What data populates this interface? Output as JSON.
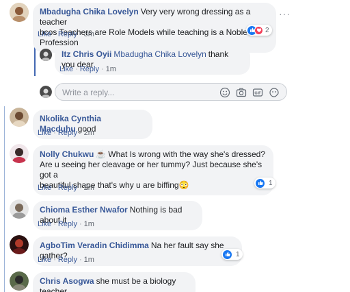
{
  "colors": {
    "link": "#385898",
    "bubble": "#f2f3f5",
    "thread_line": "#4267b2",
    "like_blue": "#1877f2",
    "love_red": "#f33e58"
  },
  "actions": {
    "like": "Like",
    "reply": "Reply",
    "separator": "·"
  },
  "reply_box": {
    "placeholder": "Write a reply...",
    "icons": [
      "smiley-icon",
      "camera-icon",
      "gif-icon",
      "sticker-icon"
    ]
  },
  "comments": [
    {
      "name": "Mbadugha Chika Lovelyn",
      "text_line1": "Very very wrong dressing as a teacher",
      "text_line2": "bcos Teachers are Role Models while teaching is a Noble Profession",
      "time": "3m",
      "reactions": [
        "like",
        "love"
      ],
      "reaction_count": "2"
    },
    {
      "name": "Itz Chris Oyii",
      "tag": "Mbadugha Chika Lovelyn",
      "text": "thank you dear",
      "time": "1m"
    },
    {
      "name": "Nkolika Cynthia Macduhu",
      "text": "good",
      "time": "2m"
    },
    {
      "name": "Nolly Chukwu",
      "name_suffix": "☕",
      "text_line1": "What Is wrong with the way she's dressed?",
      "text_line2": "Are u seeing her cleavage or her tummy? Just because she's got a",
      "text_line3": "beautiful shape that's why u are biffing",
      "emoji": "😳",
      "time": "2m",
      "reactions": [
        "like"
      ],
      "reaction_count": "1"
    },
    {
      "name": "Chioma Esther Nwafor",
      "text": "Nothing is bad about it",
      "time": "1m"
    },
    {
      "name": "AgboTim Veradin Chidimma",
      "text": "Na her fault say she gather?",
      "time": "1m",
      "reactions": [
        "like"
      ],
      "reaction_count": "1"
    },
    {
      "name": "Chris Asogwa",
      "text": "she must be a biology teacher"
    }
  ]
}
